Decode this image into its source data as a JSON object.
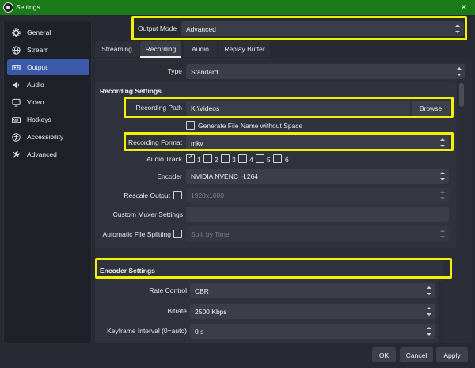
{
  "window": {
    "title": "Settings"
  },
  "sidebar": {
    "items": [
      {
        "label": "General",
        "icon": "gear-icon"
      },
      {
        "label": "Stream",
        "icon": "globe-icon"
      },
      {
        "label": "Output",
        "icon": "output-icon",
        "selected": true
      },
      {
        "label": "Audio",
        "icon": "speaker-icon"
      },
      {
        "label": "Video",
        "icon": "monitor-icon"
      },
      {
        "label": "Hotkeys",
        "icon": "keyboard-icon"
      },
      {
        "label": "Accessibility",
        "icon": "accessibility-icon"
      },
      {
        "label": "Advanced",
        "icon": "wrench-icon"
      }
    ]
  },
  "output_mode": {
    "label": "Output Mode",
    "value": "Advanced"
  },
  "tabs": [
    {
      "label": "Streaming"
    },
    {
      "label": "Recording",
      "selected": true
    },
    {
      "label": "Audio"
    },
    {
      "label": "Replay Buffer"
    }
  ],
  "type_row": {
    "label": "Type",
    "value": "Standard"
  },
  "recording_settings": {
    "title": "Recording Settings",
    "path_label": "Recording Path",
    "path_value": "K:\\Videos",
    "browse_label": "Browse",
    "gen_filename_label": "Generate File Name without Space",
    "gen_filename_checked": false,
    "format_label": "Recording Format",
    "format_value": "mkv",
    "audio_track_label": "Audio Track",
    "audio_tracks": [
      {
        "label": "1",
        "checked": true
      },
      {
        "label": "2",
        "checked": false
      },
      {
        "label": "3",
        "checked": false
      },
      {
        "label": "4",
        "checked": false
      },
      {
        "label": "5",
        "checked": false
      },
      {
        "label": "6",
        "checked": false
      }
    ],
    "encoder_label": "Encoder",
    "encoder_value": "NVIDIA NVENC H.264",
    "rescale_label": "Rescale Output",
    "rescale_value": "1920x1080",
    "muxer_label": "Custom Muxer Settings",
    "muxer_value": "",
    "split_label": "Automatic File Splitting",
    "split_value": "Split by Time"
  },
  "encoder_settings": {
    "title": "Encoder Settings",
    "rate_control_label": "Rate Control",
    "rate_control_value": "CBR",
    "bitrate_label": "Bitrate",
    "bitrate_value": "2500 Kbps",
    "keyframe_label": "Keyframe Interval (0=auto)",
    "keyframe_value": "0 s"
  },
  "footer": {
    "ok_label": "OK",
    "cancel_label": "Cancel",
    "apply_label": "Apply"
  },
  "colors": {
    "titlebar": "#1a7a1a",
    "selection": "#3a59a8",
    "highlight": "#f2f200",
    "background": "#272a33"
  }
}
